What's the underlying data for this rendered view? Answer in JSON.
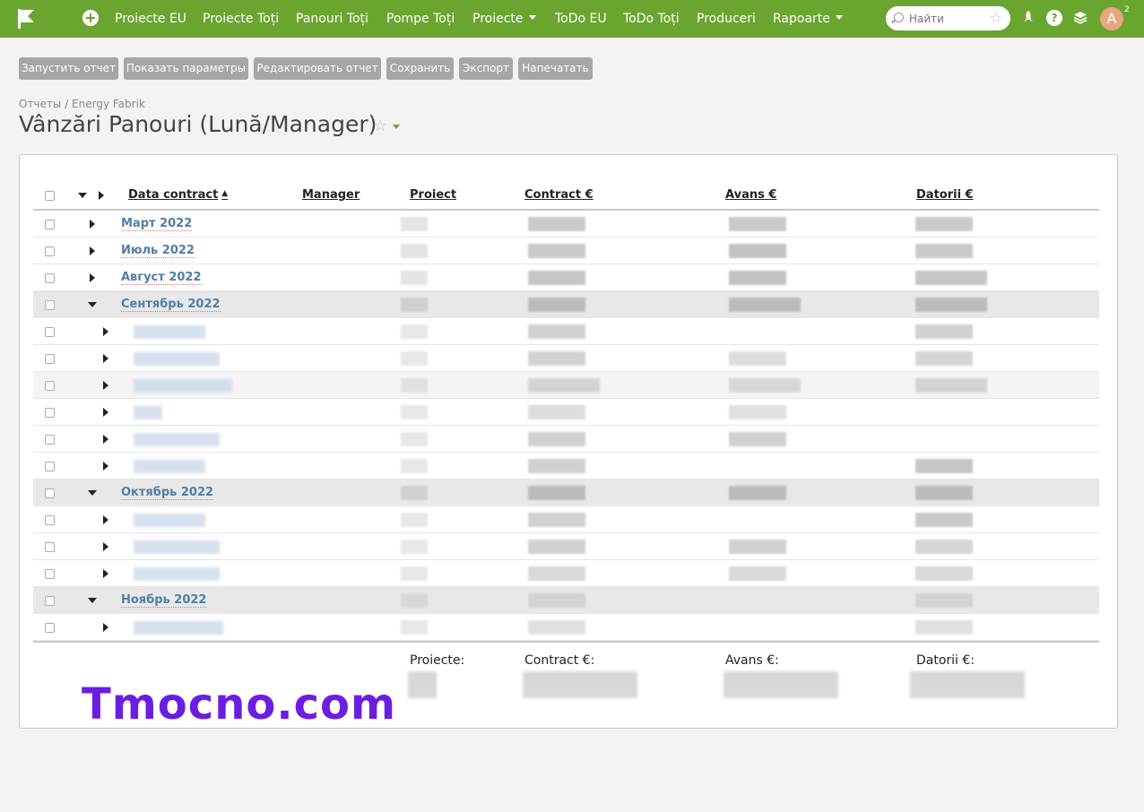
{
  "topnav": {
    "items": [
      {
        "label": "Proiecte EU"
      },
      {
        "label": "Proiecte Toți"
      },
      {
        "label": "Panouri Toți"
      },
      {
        "label": "Pompe Toți"
      },
      {
        "label": "Proiecte"
      },
      {
        "label": "ToDo EU"
      },
      {
        "label": "ToDo Toți"
      },
      {
        "label": "Produceri"
      },
      {
        "label": "Rapoarte"
      }
    ],
    "search_placeholder": "Найти",
    "avatar_letter": "A",
    "notification_count": "2",
    "brand_color": "#6aa62f"
  },
  "toolbar": {
    "run": "Запустить отчет",
    "show_params": "Показать параметры",
    "edit": "Редактировать отчет",
    "save": "Сохранить",
    "export": "Экспорт",
    "print": "Напечатать"
  },
  "breadcrumb": "Отчеты / Energy Fabrik",
  "title": "Vânzări Panouri (Lună/Manager)",
  "table": {
    "columns": {
      "date": "Data contract",
      "manager": "Manager",
      "project": "Proiect",
      "contract": "Contract €",
      "advance": "Avans €",
      "debt": "Datorii €"
    },
    "groups": [
      {
        "label": "Март 2022",
        "expanded": false
      },
      {
        "label": "Июль 2022",
        "expanded": false
      },
      {
        "label": "Август 2022",
        "expanded": false
      },
      {
        "label": "Сентябрь 2022",
        "expanded": true
      },
      {
        "label": "Октябрь 2022",
        "expanded": true
      },
      {
        "label": "Ноябрь 2022",
        "expanded": true
      }
    ]
  },
  "totals": {
    "projects": "Proiecte:",
    "contract": "Contract €:",
    "advance": "Avans €:",
    "debt": "Datorii €:"
  },
  "watermark": "Tmocno.com"
}
